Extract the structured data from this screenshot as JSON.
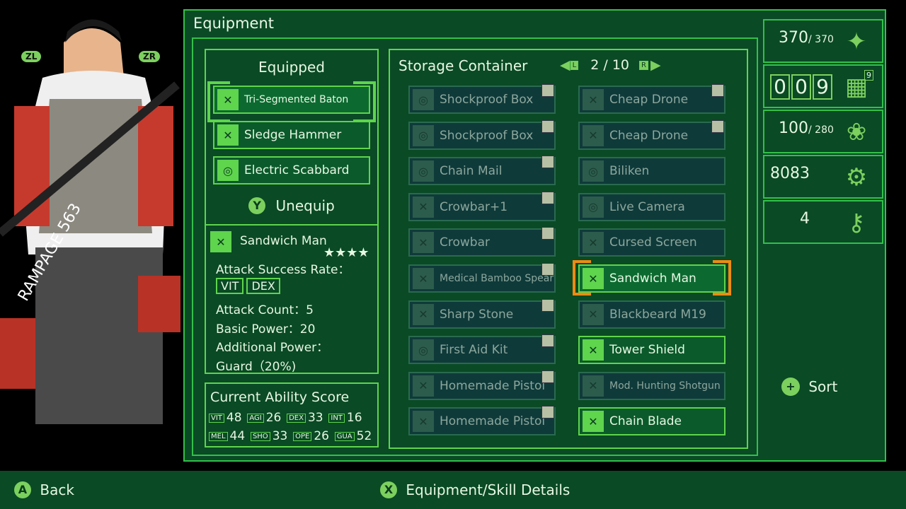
{
  "title": "Equipment",
  "equipped": {
    "heading": "Equipped",
    "items": [
      {
        "name": "Tri-Segmented Baton",
        "icon": "baton-icon"
      },
      {
        "name": "Sledge Hammer",
        "icon": "baton-icon"
      },
      {
        "name": "Electric Scabbard",
        "icon": "armor-icon"
      }
    ],
    "unequip_button": "Y",
    "unequip_label": "Unequip"
  },
  "details": {
    "name": "Sandwich Man",
    "stars": "★★★★",
    "attack_rate_label": "Attack Success Rate：",
    "tags": [
      "VIT",
      "DEX"
    ],
    "attack_count": "Attack Count：5",
    "basic_power": "Basic Power：20",
    "additional_power_label": "Additional Power：",
    "guard": "Guard（20%)"
  },
  "ability": {
    "heading": "Current Ability Score",
    "scores": [
      {
        "label": "VIT",
        "value": "48"
      },
      {
        "label": "AGI",
        "value": "26"
      },
      {
        "label": "DEX",
        "value": "33"
      },
      {
        "label": "INT",
        "value": "16"
      },
      {
        "label": "MEL",
        "value": "44"
      },
      {
        "label": "SHO",
        "value": "33"
      },
      {
        "label": "OPE",
        "value": "26"
      },
      {
        "label": "GUA",
        "value": "52"
      }
    ]
  },
  "storage": {
    "heading": "Storage Container",
    "page_left": "L",
    "page_right": "R",
    "page": "2 / 10",
    "left_items": [
      "Shockproof Box",
      "Shockproof Box",
      "Chain Mail",
      "Crowbar+1",
      "Crowbar",
      "Medical Bamboo Spear",
      "Sharp Stone",
      "First Aid Kit",
      "Homemade Pistol",
      "Homemade Pistol"
    ],
    "right_items": [
      "Cheap Drone",
      "Cheap Drone",
      "Biliken",
      "Live Camera",
      "Cursed Screen",
      "Sandwich Man",
      "Blackbeard M19",
      "Tower Shield",
      "Mod. Hunting Shotgun",
      "Chain Blade"
    ]
  },
  "resources": {
    "energy": "370",
    "energy_max": "/ 370",
    "days": [
      "0",
      "0",
      "9"
    ],
    "days_badge": "9",
    "food": "100",
    "food_max": "/ 280",
    "parts": "8083",
    "keys": "4"
  },
  "sort_label": "Sort",
  "footer": {
    "back_button": "A",
    "back_label": "Back",
    "details_button": "X",
    "details_label": "Equipment/Skill Details"
  },
  "character": {
    "shoulder_left": "ZL",
    "shoulder_right": "ZR"
  },
  "colors": {
    "panel": "#0a4a25",
    "border": "#33c04a",
    "selected": "#f08a12",
    "dim": "#0f3a3a"
  }
}
